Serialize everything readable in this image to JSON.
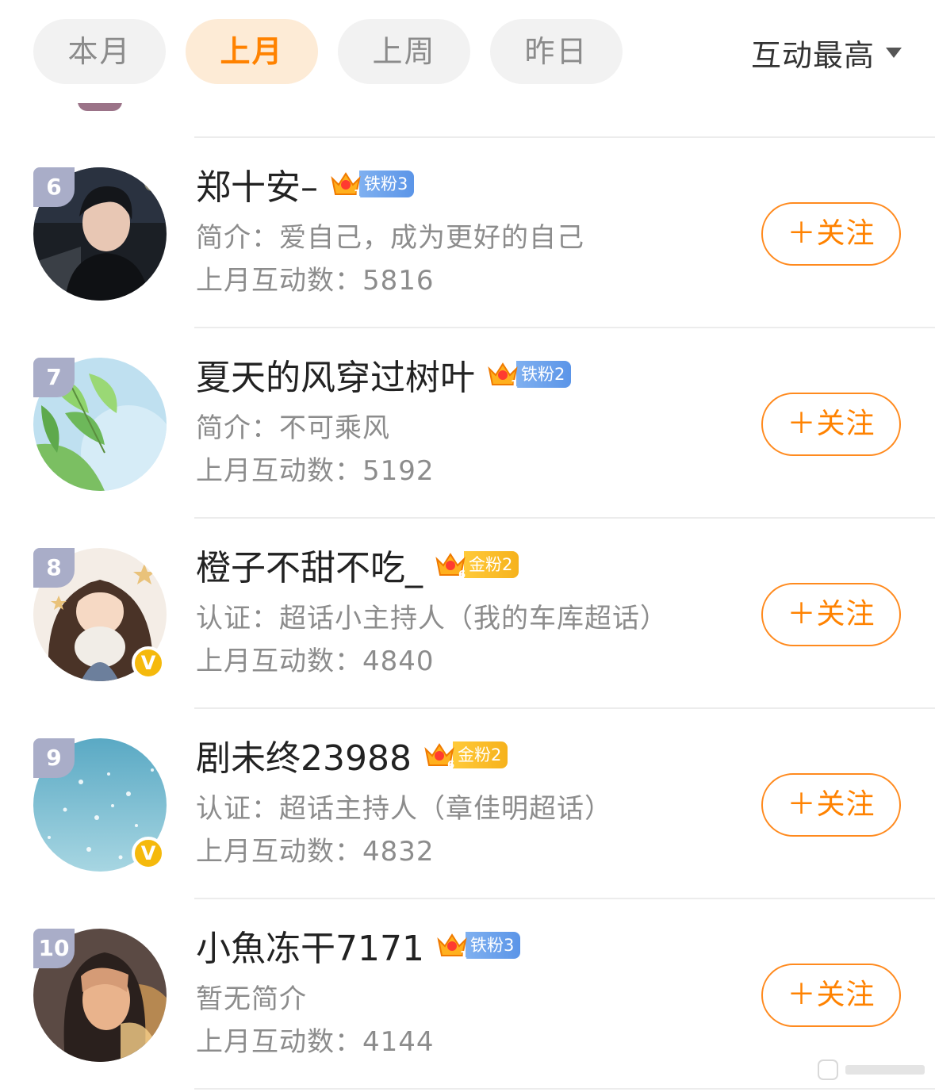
{
  "tabs": [
    {
      "label": "本月",
      "active": false
    },
    {
      "label": "上月",
      "active": true
    },
    {
      "label": "上周",
      "active": false
    },
    {
      "label": "昨日",
      "active": false
    }
  ],
  "sort": {
    "label": "互动最高"
  },
  "colors": {
    "accent": "#ff8200",
    "active_tab_bg": "#fdebd6",
    "rank_badge": "#a9adc8",
    "iron_fan": "#5b95e8",
    "gold_fan": "#f6b21c",
    "verified": "#f5b90c"
  },
  "follow_label": "＋关注",
  "rows": [
    {
      "rank": "6",
      "name": "郑十安–",
      "crown_level": "1",
      "fan": "铁粉3",
      "fan_type": "iron",
      "intro": "简介：爱自己，成为更好的自己",
      "count": "上月互动数：5816",
      "verified": false
    },
    {
      "rank": "7",
      "name": "夏天的风穿过树叶",
      "crown_level": "1",
      "fan": "铁粉2",
      "fan_type": "iron",
      "intro": "简介：不可乘风",
      "count": "上月互动数：5192",
      "verified": false
    },
    {
      "rank": "8",
      "name": "橙子不甜不吃_",
      "crown_level": "6",
      "fan": "金粉2",
      "fan_type": "gold",
      "intro": "认证：超话小主持人（我的车库超话）",
      "count": "上月互动数：4840",
      "verified": true
    },
    {
      "rank": "9",
      "name": "剧未终23988",
      "crown_level": "6",
      "fan": "金粉2",
      "fan_type": "gold",
      "intro": "认证：超话主持人（章佳明超话）",
      "count": "上月互动数：4832",
      "verified": true
    },
    {
      "rank": "10",
      "name": "小魚冻干7171",
      "crown_level": "1",
      "fan": "铁粉3",
      "fan_type": "iron",
      "intro": "暂无简介",
      "count": "上月互动数：4144",
      "verified": false
    }
  ]
}
